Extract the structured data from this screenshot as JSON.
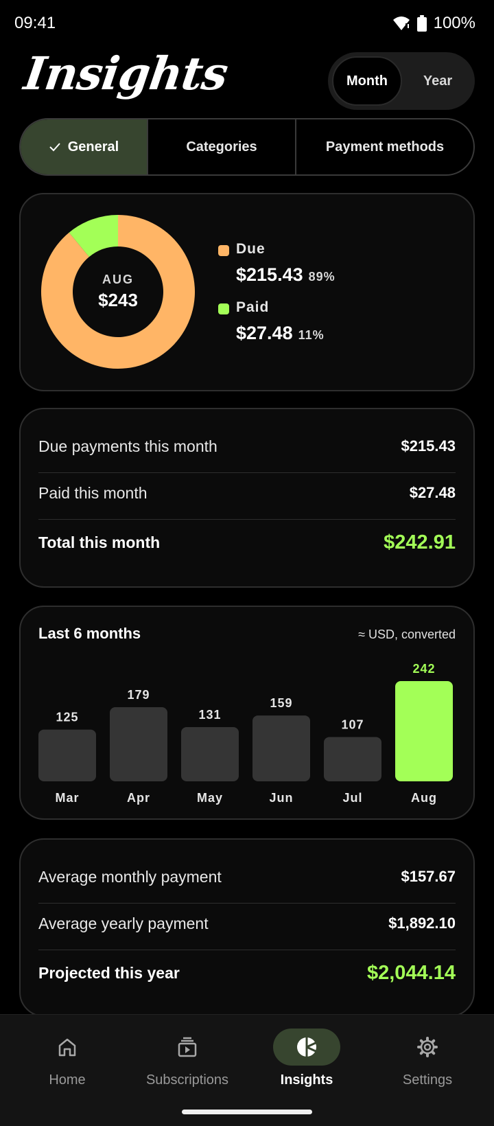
{
  "status_bar": {
    "time": "09:41",
    "battery": "100%"
  },
  "header": {
    "title": "Insights"
  },
  "period_toggle": {
    "month": "Month",
    "year": "Year",
    "selected": "Month"
  },
  "tabs": [
    {
      "label": "General",
      "selected": true
    },
    {
      "label": "Categories",
      "selected": false
    },
    {
      "label": "Payment methods",
      "selected": false
    }
  ],
  "donut": {
    "month": "AUG",
    "total": "$243",
    "segments": [
      {
        "name": "Due",
        "amount": "$215.43",
        "percent": "89%",
        "value": 89,
        "color": "#ffb566"
      },
      {
        "name": "Paid",
        "amount": "$27.48",
        "percent": "11%",
        "value": 11,
        "color": "#a3ff57"
      }
    ]
  },
  "summary": {
    "due_label": "Due payments this month",
    "due_value": "$215.43",
    "paid_label": "Paid this month",
    "paid_value": "$27.48",
    "total_label": "Total this month",
    "total_value": "$242.91"
  },
  "chart_data": {
    "type": "bar",
    "title": "Last 6 months",
    "note": "≈ USD, converted",
    "categories": [
      "Mar",
      "Apr",
      "May",
      "Jun",
      "Jul",
      "Aug"
    ],
    "values": [
      125,
      179,
      131,
      159,
      107,
      242
    ],
    "highlight": "Aug",
    "colors": {
      "default": "#353535",
      "highlight": "#a3ff57"
    }
  },
  "averages": {
    "monthly_label": "Average monthly payment",
    "monthly_value": "$157.67",
    "yearly_label": "Average yearly payment",
    "yearly_value": "$1,892.10",
    "projected_label": "Projected this year",
    "projected_value": "$2,044.14"
  },
  "nav": [
    {
      "label": "Home",
      "icon": "home-icon",
      "active": false
    },
    {
      "label": "Subscriptions",
      "icon": "subscriptions-icon",
      "active": false
    },
    {
      "label": "Insights",
      "icon": "pie-chart-icon",
      "active": true
    },
    {
      "label": "Settings",
      "icon": "gear-icon",
      "active": false
    }
  ],
  "colors": {
    "accent": "#a3ff57",
    "due": "#ffb566",
    "selected_bg": "#37452f"
  }
}
